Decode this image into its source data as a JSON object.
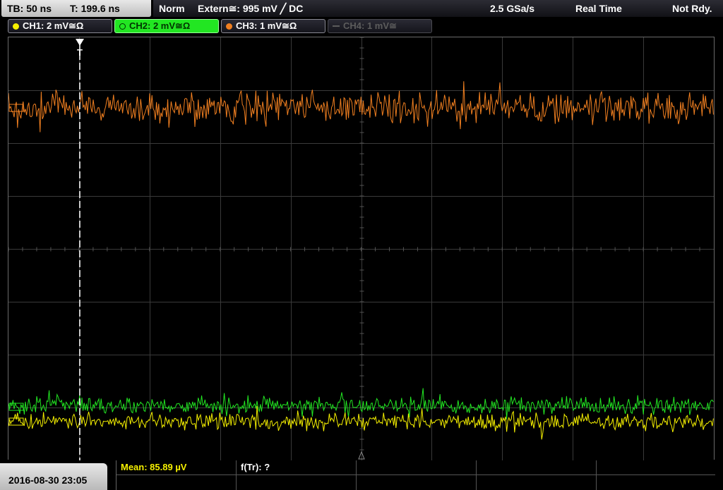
{
  "topbar": {
    "timebase": "TB: 50 ns",
    "trigger_pos": "T: 199.6 ns",
    "mode": "Norm",
    "trigger_source": "Extern≅: 995 mV ╱ DC",
    "sample_rate": "2.5 GSa/s",
    "acq_mode": "Real Time",
    "status": "Not Rdy."
  },
  "channels": [
    {
      "label": "CH1: 2 mV≅Ω",
      "color": "#f5f000",
      "state": "on"
    },
    {
      "label": "CH2: 2 mV≅Ω",
      "color": "#22e622",
      "state": "active"
    },
    {
      "label": "CH3: 1 mV≅Ω",
      "color": "#f07f20",
      "state": "on"
    },
    {
      "label": "CH4: 1 mV≅",
      "color": "#5c5c5c",
      "state": "off"
    }
  ],
  "display": {
    "trigger_marker": "T",
    "grid_color": "#3a3a3a",
    "trace_colors": {
      "ch1": "#f5f000",
      "ch2": "#22e622",
      "ch3": "#f07f20"
    }
  },
  "bottom": {
    "datetime": "2016-08-30 23:05",
    "measurement_1": "Mean: 85.89 µV",
    "measurement_1_color": "#f5f000",
    "measurement_2": "f(Tr): ?"
  }
}
